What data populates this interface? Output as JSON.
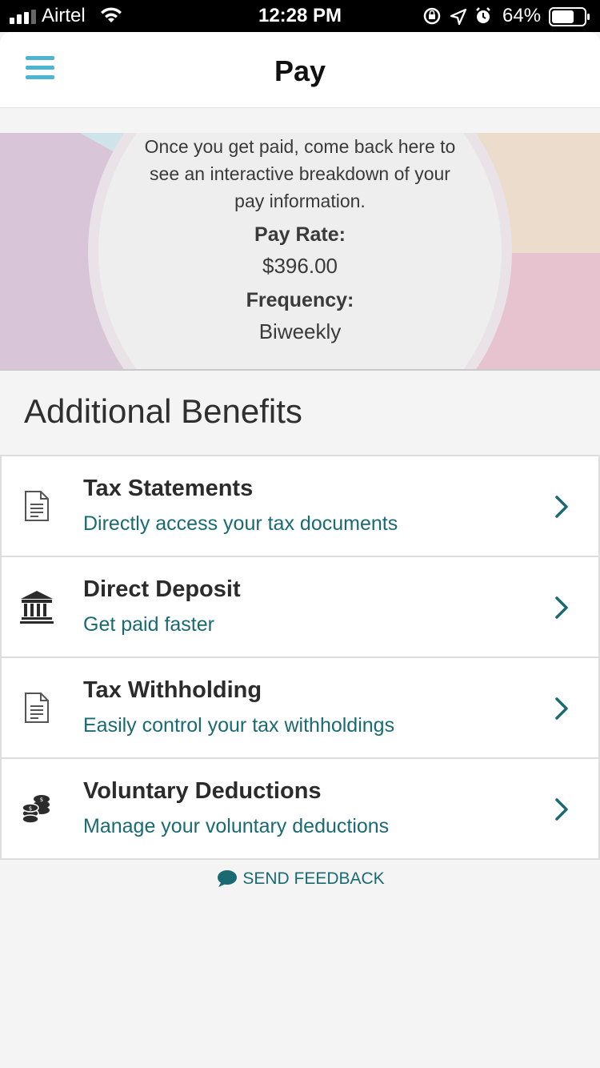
{
  "status_bar": {
    "carrier": "Airtel",
    "time": "12:28 PM",
    "battery_percent": "64%"
  },
  "nav": {
    "title": "Pay"
  },
  "hero": {
    "message": "Once you get paid, come back here to see an interactive breakdown of your pay information.",
    "pay_rate_label": "Pay Rate:",
    "pay_rate_value": "$396.00",
    "frequency_label": "Frequency:",
    "frequency_value": "Biweekly",
    "colors": {
      "purple": "#d8c6d8",
      "peach": "#ecdccb",
      "pink": "#e6c3cf",
      "teal": "#cfe4ea",
      "center": "#eeeeee"
    }
  },
  "section": {
    "title": "Additional Benefits"
  },
  "benefits": [
    {
      "title": "Tax Statements",
      "subtitle": "Directly access your tax documents",
      "icon": "document-icon"
    },
    {
      "title": "Direct Deposit",
      "subtitle": "Get paid faster",
      "icon": "bank-icon"
    },
    {
      "title": "Tax Withholding",
      "subtitle": "Easily control your tax withholdings",
      "icon": "document-icon"
    },
    {
      "title": "Voluntary Deductions",
      "subtitle": "Manage your voluntary deductions",
      "icon": "coins-icon"
    }
  ],
  "feedback": {
    "label": "SEND FEEDBACK"
  },
  "colors": {
    "accent_blue": "#4bb5d3",
    "accent_teal": "#1a6a72"
  }
}
